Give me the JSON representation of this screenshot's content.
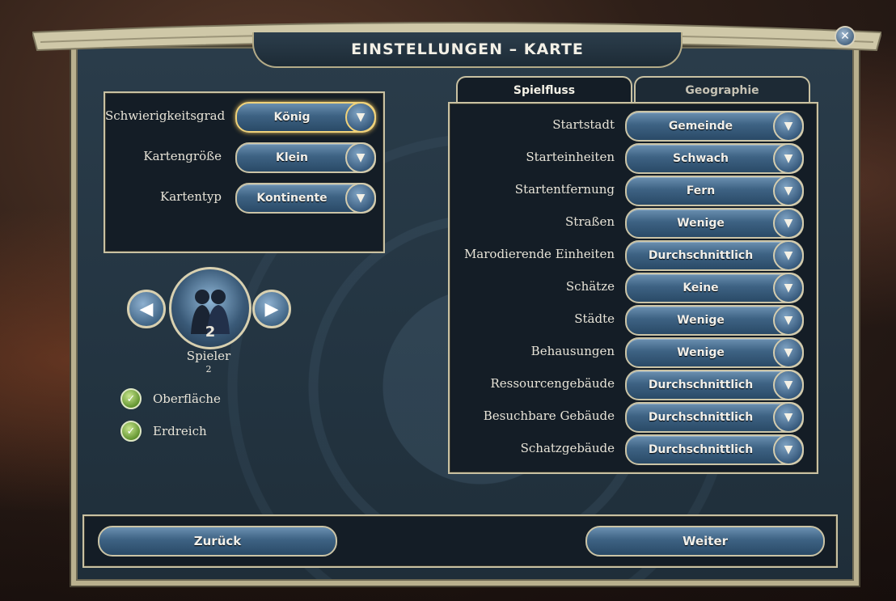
{
  "window": {
    "title": "EINSTELLUNGEN – KARTE",
    "close_icon": "close-icon"
  },
  "map_settings": [
    {
      "label": "Schwierigkeitsgrad",
      "value": "König"
    },
    {
      "label": "Kartengröße",
      "value": "Klein"
    },
    {
      "label": "Kartentyp",
      "value": "Kontinente"
    }
  ],
  "players": {
    "label": "Spieler",
    "count": "2",
    "sub": "2",
    "prev_icon": "arrow-left-icon",
    "next_icon": "arrow-right-icon"
  },
  "levels": [
    {
      "label": "Oberfläche",
      "checked": true
    },
    {
      "label": "Erdreich",
      "checked": true
    }
  ],
  "tabs": [
    {
      "label": "Spielfluss",
      "active": true
    },
    {
      "label": "Geographie",
      "active": false
    }
  ],
  "gameflow": [
    {
      "label": "Startstadt",
      "value": "Gemeinde"
    },
    {
      "label": "Starteinheiten",
      "value": "Schwach"
    },
    {
      "label": "Startentfernung",
      "value": "Fern"
    },
    {
      "label": "Straßen",
      "value": "Wenige"
    },
    {
      "label": "Marodierende Einheiten",
      "value": "Durchschnittlich"
    },
    {
      "label": "Schätze",
      "value": "Keine"
    },
    {
      "label": "Städte",
      "value": "Wenige"
    },
    {
      "label": "Behausungen",
      "value": "Wenige"
    },
    {
      "label": "Ressourcengebäude",
      "value": "Durchschnittlich"
    },
    {
      "label": "Besuchbare Gebäude",
      "value": "Durchschnittlich"
    },
    {
      "label": "Schatzgebäude",
      "value": "Durchschnittlich"
    }
  ],
  "footer": {
    "back_label": "Zurück",
    "next_label": "Weiter"
  }
}
